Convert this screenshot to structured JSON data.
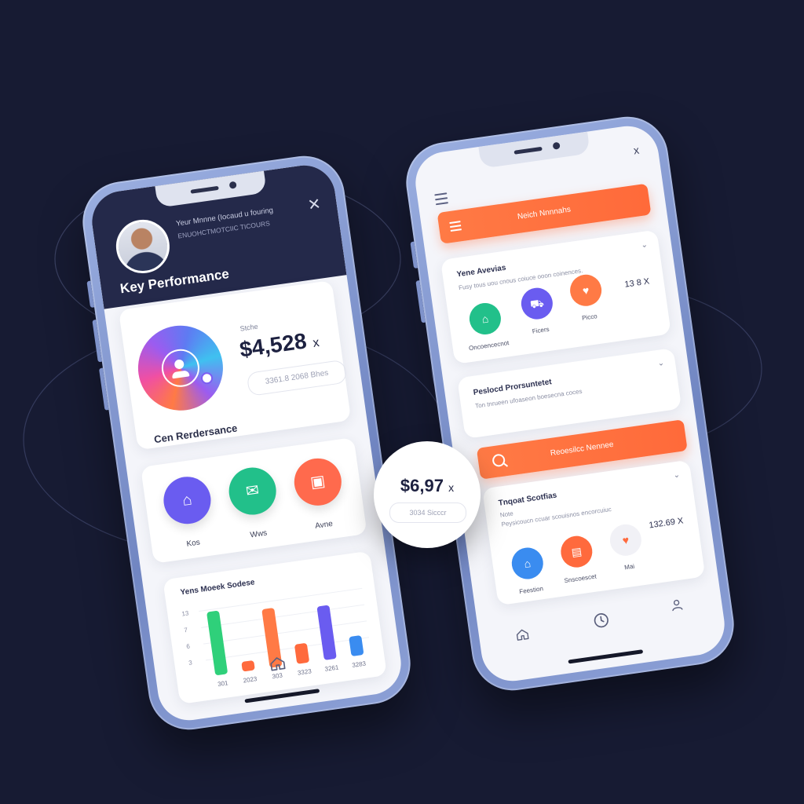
{
  "left_phone": {
    "header": {
      "line1": "Yeur Mnnne (Iocaud u fouring",
      "line2": "ENUOHCTMOTCIIC TICOURS",
      "title": "Key Performance",
      "close_icon": "close-icon"
    },
    "kpi": {
      "small_label": "Stche",
      "value": "$4,528",
      "suffix": "x",
      "pill": "3361.8 2068 Bhes",
      "subtitle": "Cen Rerdersance"
    },
    "categories": [
      {
        "label": "Kos",
        "icon": "home-icon",
        "color": "#6a5cf0"
      },
      {
        "label": "Wws",
        "icon": "chat-icon",
        "color": "#22c08a"
      },
      {
        "label": "Avne",
        "icon": "briefcase-icon",
        "color": "#ff6a4d"
      }
    ],
    "tab_icon": "home-icon"
  },
  "chart_data": {
    "type": "bar",
    "title": "Yens Moeek Sodese",
    "categories": [
      "301",
      "2023",
      "303",
      "3323",
      "3261",
      "3283"
    ],
    "values": [
      13,
      2,
      12,
      4,
      11,
      4
    ],
    "colors": [
      "#2fd07a",
      "#ff6a3d",
      "#ff7a45",
      "#ff6a3d",
      "#6a5cf0",
      "#3a8cf0"
    ],
    "y_ticks": [
      "13",
      "7",
      "6",
      "3"
    ],
    "ylim": [
      0,
      15
    ]
  },
  "bubble": {
    "value": "$6,97",
    "suffix": "x",
    "pill": "3034 Sicccr"
  },
  "right_phone": {
    "top_close": "x",
    "search_bar": "Neich Nnnnahs",
    "card1": {
      "title": "Yene Avevias",
      "sub": "Fusy tous uou cnous coiuce ooon coinences.",
      "chevron": "⌄",
      "items": [
        {
          "label": "Oncoencecnot",
          "icon": "home-icon",
          "color": "#22c08a"
        },
        {
          "label": "Ficers",
          "icon": "car-icon",
          "color": "#6a5cf0"
        },
        {
          "label": "Picco",
          "icon": "heart-icon",
          "color": "#ff7a45"
        }
      ],
      "value": "13 8 X"
    },
    "card2": {
      "title": "Peslocd Prorsuntetet",
      "sub": "Ton tnrueen ufoaseon boesecna coces",
      "chevron": "⌄"
    },
    "action_bar": "Reoesilcc Nennee",
    "card3": {
      "title": "Tnqoat Scotfias",
      "sub1": "Note",
      "sub2": "Peysicoucn ccuar scouisnos encorcuiuc",
      "chevron": "⌄",
      "items": [
        {
          "label": "Feestion",
          "icon": "home-icon",
          "color": "#3a8cf0"
        },
        {
          "label": "Snscoescet",
          "icon": "wallet-icon",
          "color": "#ff6a3d"
        },
        {
          "label": "Mai",
          "icon": "heart-icon",
          "color": "#f4f4f8"
        }
      ],
      "value": "132.69 X"
    },
    "tabs": [
      "home-icon",
      "clock-icon",
      "profile-icon"
    ]
  }
}
